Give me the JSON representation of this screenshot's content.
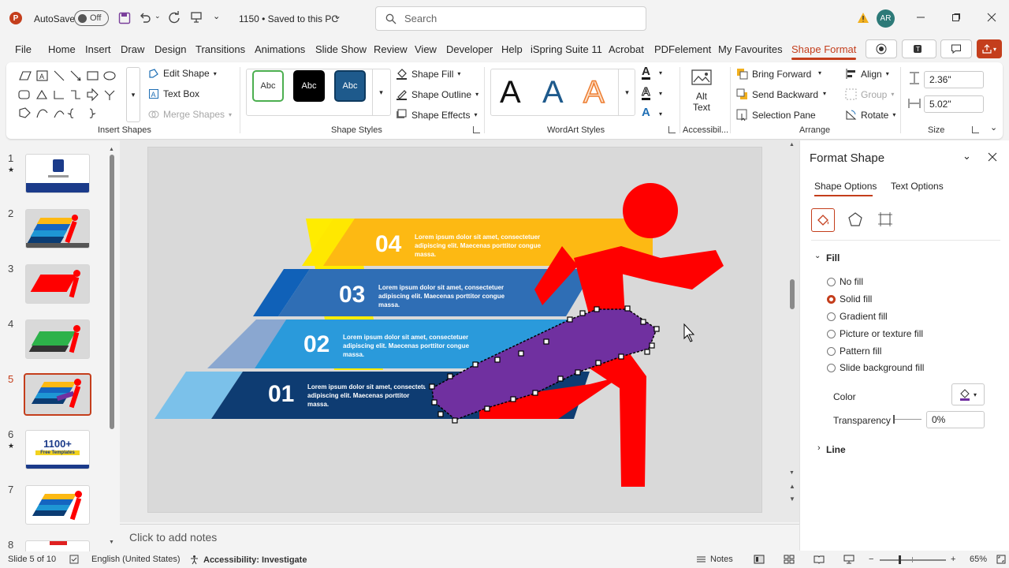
{
  "titlebar": {
    "autosave_label": "AutoSave",
    "autosave_state": "Off",
    "file_status": "1150 • Saved to this PC",
    "search_placeholder": "Search",
    "user_initials": "AR"
  },
  "menu": {
    "tabs": [
      "File",
      "Home",
      "Insert",
      "Draw",
      "Design",
      "Transitions",
      "Animations",
      "Slide Show",
      "Review",
      "View",
      "Developer",
      "Help",
      "iSpring Suite 11",
      "Acrobat",
      "PDFelement",
      "My Favourites",
      "Shape Format"
    ],
    "active_tab": "Shape Format"
  },
  "ribbon": {
    "insert_shapes": {
      "label": "Insert Shapes",
      "edit_shape": "Edit Shape",
      "text_box": "Text Box",
      "merge_shapes": "Merge Shapes"
    },
    "shape_styles": {
      "label": "Shape Styles",
      "style_sample": "Abc",
      "fill": "Shape Fill",
      "outline": "Shape Outline",
      "effects": "Shape Effects"
    },
    "wordart": {
      "label": "WordArt Styles",
      "sample": "A"
    },
    "accessibility": {
      "label": "Accessibil...",
      "alt_text_1": "Alt",
      "alt_text_2": "Text"
    },
    "arrange": {
      "label": "Arrange",
      "bring_forward": "Bring Forward",
      "send_backward": "Send Backward",
      "selection_pane": "Selection Pane",
      "align": "Align",
      "group": "Group",
      "rotate": "Rotate"
    },
    "size": {
      "label": "Size",
      "height": "2.36\"",
      "width": "5.02\""
    }
  },
  "slides": {
    "numbers": [
      "1",
      "2",
      "3",
      "4",
      "5",
      "6",
      "7",
      "8"
    ],
    "selected": "5",
    "thumb6_text_1": "1100+",
    "thumb6_text_2": "Free Templates"
  },
  "slide_content": {
    "steps": [
      {
        "num": "04",
        "color": "#fdb913",
        "text_1": "Lorem ipsum dolor sit amet, consectetuer",
        "text_2": "adipiscing elit. Maecenas porttitor congue",
        "text_3": "massa."
      },
      {
        "num": "03",
        "color": "#1565c0",
        "text_1": "Lorem ipsum dolor sit amet, consectetuer",
        "text_2": "adipiscing elit. Maecenas porttitor congue",
        "text_3": "massa."
      },
      {
        "num": "02",
        "color": "#1e96d4",
        "text_1": "Lorem ipsum dolor sit amet, consectetuer",
        "text_2": "adipiscing elit. Maecenas porttitor congue",
        "text_3": "massa."
      },
      {
        "num": "01",
        "color": "#0b3c73",
        "text_1": "Lorem ipsum dolor sit amet, consectetuer",
        "text_2": "adipiscing elit. Maecenas porttitor",
        "text_3": "massa."
      }
    ],
    "runner_color": "#ff0000",
    "selected_shape_color": "#7030a0"
  },
  "notes": {
    "placeholder": "Click to add notes"
  },
  "format_pane": {
    "title": "Format Shape",
    "tabs": [
      "Shape Options",
      "Text Options"
    ],
    "fill_section": "Fill",
    "fill_options": [
      "No fill",
      "Solid fill",
      "Gradient fill",
      "Picture or texture fill",
      "Pattern fill",
      "Slide background fill"
    ],
    "selected_fill": "Solid fill",
    "color_label": "Color",
    "transparency_label": "Transparency",
    "transparency_value": "0%",
    "line_section": "Line"
  },
  "statusbar": {
    "slide_info": "Slide 5 of 10",
    "language": "English (United States)",
    "accessibility": "Accessibility: Investigate",
    "notes": "Notes",
    "zoom": "65%"
  },
  "colors": {
    "accent": "#c43e1c",
    "selected_shape": "#7030a0"
  }
}
